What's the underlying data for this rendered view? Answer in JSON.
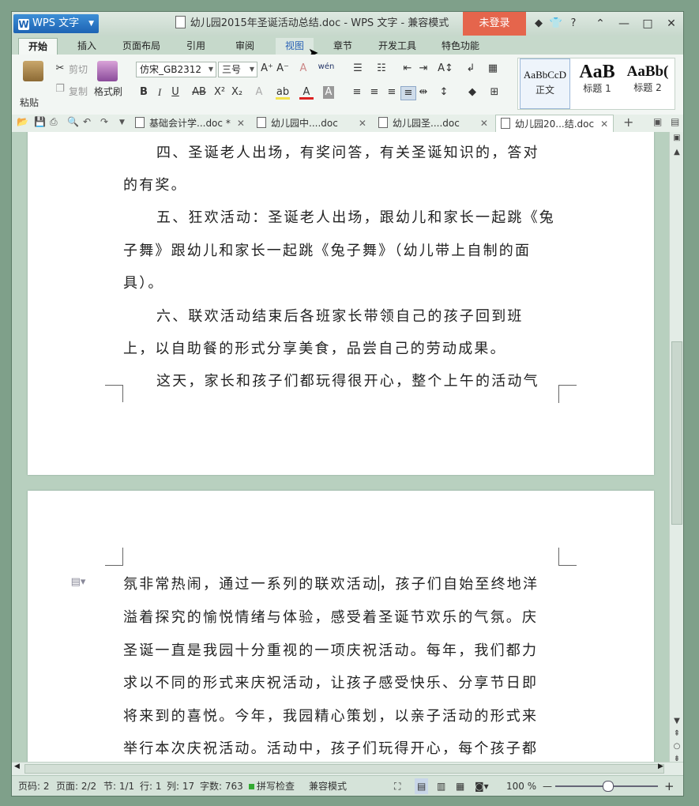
{
  "titlebar": {
    "app_button": "WPS 文字",
    "title": "幼儿园2015年圣诞活动总结.doc - WPS 文字 - 兼容模式",
    "login": "未登录"
  },
  "tabs": [
    "开始",
    "插入",
    "页面布局",
    "引用",
    "审阅",
    "视图",
    "章节",
    "开发工具",
    "特色功能"
  ],
  "ribbon": {
    "paste": "粘贴",
    "cut": "剪切",
    "copy": "复制",
    "format_painter": "格式刷",
    "font_name": "仿宋_GB2312",
    "font_size": "三号",
    "styles": [
      {
        "sample": "AaBbCcD",
        "name": "正文"
      },
      {
        "sample": "AaB",
        "name": "标题 1"
      },
      {
        "sample": "AaBb(",
        "name": "标题 2"
      }
    ]
  },
  "doc_tabs": [
    "基础会计学...doc *",
    "幼儿园中....doc",
    "幼儿园圣....doc",
    "幼儿园20...结.doc"
  ],
  "page1_lines": [
    "四、圣诞老人出场，有奖问答，有关圣诞知识的，答对",
    "的有奖。",
    "五、狂欢活动：圣诞老人出场，跟幼儿和家长一起跳《兔",
    "子舞》跟幼儿和家长一起跳《兔子舞》（幼儿带上自制的面",
    "具）。",
    "六、联欢活动结束后各班家长带领自己的孩子回到班",
    "上，以自助餐的形式分享美食，品尝自己的劳动成果。",
    "这天，家长和孩子们都玩得很开心，整个上午的活动气"
  ],
  "page2": {
    "line1_before_caret": "氛非常热闹，通过一系列的联欢活动",
    "line1_after_caret": "，孩子们自始至终地洋",
    "lines": [
      "溢着探究的愉悦情绪与体验，感受着圣诞节欢乐的气氛。庆",
      "圣诞一直是我园十分重视的一项庆祝活动。每年，我们都力",
      "求以不同的形式来庆祝活动，让孩子感受快乐、分享节日即",
      "将来到的喜悦。今年，我园精心策划，以亲子活动的形式来",
      "举行本次庆祝活动。活动中，孩子们玩得开心，每个孩子都"
    ]
  },
  "status": {
    "page_num": "页码: 2",
    "pages": "页面: 2/2",
    "section": "节: 1/1",
    "row": "行: 1",
    "col": "列: 17",
    "words": "字数: 763",
    "spell": "拼写检查",
    "mode": "兼容模式",
    "zoom": "100 %"
  }
}
